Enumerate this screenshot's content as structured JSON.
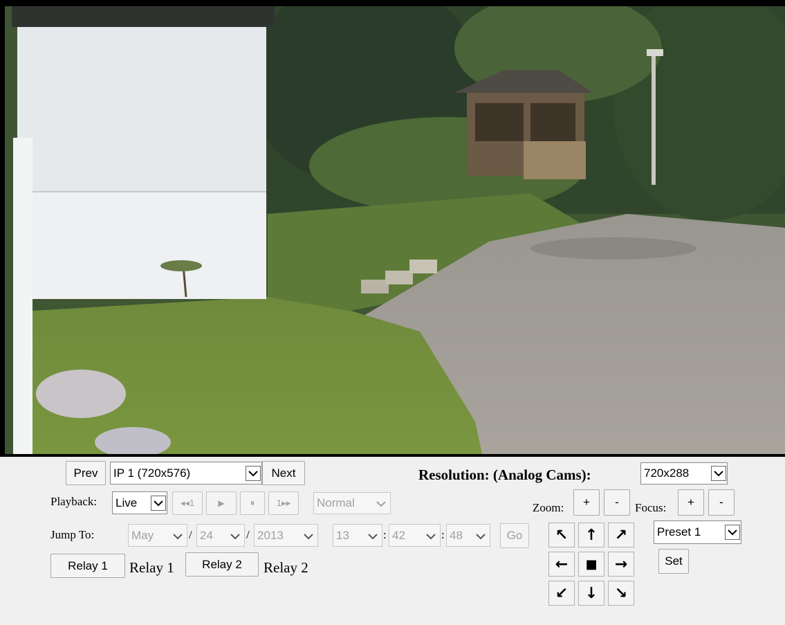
{
  "nav": {
    "prev_label": "Prev",
    "next_label": "Next",
    "camera_selected": "IP 1 (720x576)"
  },
  "resolution": {
    "label": "Resolution: (Analog Cams):",
    "selected": "720x288"
  },
  "playback": {
    "label": "Playback:",
    "mode_selected": "Live",
    "rewind_label": "◂◂1",
    "play_label": "▶",
    "pause_label": "⏸",
    "forward_label": "1▸▸",
    "speed_selected": "Normal"
  },
  "zoom": {
    "label": "Zoom:",
    "in_label": "+",
    "out_label": "-"
  },
  "focus": {
    "label": "Focus:",
    "in_label": "+",
    "out_label": "-"
  },
  "jump": {
    "label": "Jump To:",
    "month": "May",
    "day": "24",
    "year": "2013",
    "hour": "13",
    "minute": "42",
    "second": "48",
    "date_sep": "/",
    "time_sep": ":",
    "go_label": "Go"
  },
  "relays": [
    {
      "button_label": "Relay 1",
      "status_label": "Relay 1"
    },
    {
      "button_label": "Relay 2",
      "status_label": "Relay 2"
    }
  ],
  "ptz": {
    "up_left": "↖",
    "up": "↑",
    "up_right": "↗",
    "left": "←",
    "stop": "■",
    "right": "→",
    "down_left": "↙",
    "down": "↓",
    "down_right": "↘"
  },
  "preset": {
    "selected": "Preset 1",
    "set_label": "Set"
  },
  "icons": {
    "dropdown": "chevron-down-icon"
  }
}
